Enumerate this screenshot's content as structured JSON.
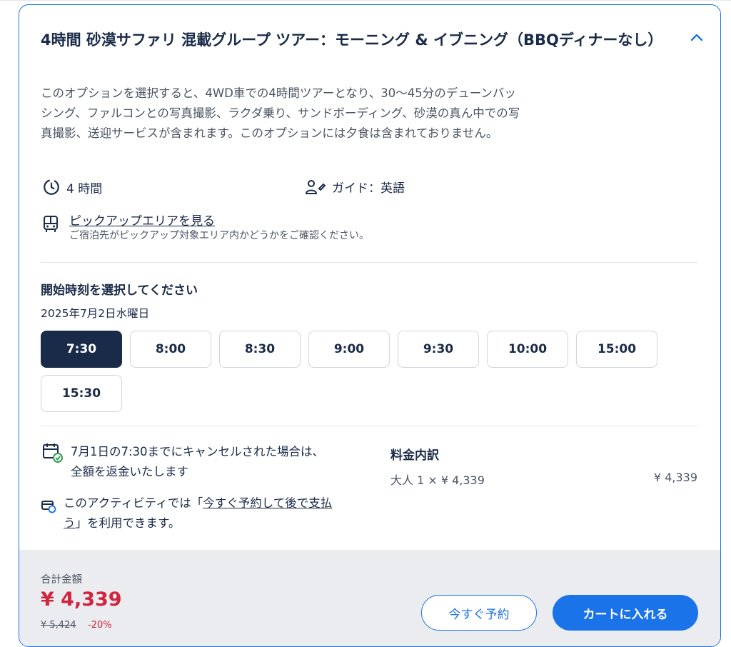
{
  "option": {
    "title": "4時間 砂漠サファリ 混載グループ ツアー：モーニング & イブニング（BBQディナーなし）",
    "description": "このオプションを選択すると、4WD車での4時間ツアーとなり、30〜45分のデューンバッシング、ファルコンとの写真撮影、ラクダ乗り、サンドボーディング、砂漠の真ん中での写真撮影、送迎サービスが含まれます。このオプションには夕食は含まれておりません。",
    "duration": "4 時間",
    "guide": "ガイド：英語",
    "pickup_link": "ピックアップエリアを見る",
    "pickup_sub": "ご宿泊先がピックアップ対象エリア内かどうかをご確認ください。"
  },
  "schedule": {
    "title": "開始時刻を選択してください",
    "date": "2025年7月2日水曜日",
    "times": [
      "7:30",
      "8:00",
      "8:30",
      "9:00",
      "9:30",
      "10:00",
      "15:00",
      "15:30"
    ],
    "selected": "7:30"
  },
  "cancellation": {
    "text": "7月1日の7:30までにキャンセルされた場合は、全額を返金いたします"
  },
  "paylater": {
    "prefix": "このアクティビティでは「",
    "link": "今すぐ予約して後で支払う",
    "suffix": "」を利用できます。"
  },
  "price_breakdown": {
    "title": "料金内訳",
    "line_label": "大人 1 × ¥ 4,339",
    "line_amount": "¥ 4,339"
  },
  "footer": {
    "total_label": "合計金額",
    "total_price": "¥ 4,339",
    "original_price": "¥ 5,424",
    "discount": "-20%",
    "reserve_label": "今すぐ予約",
    "cart_label": "カートに入れる"
  },
  "colors": {
    "primary": "#1a73e8",
    "navy": "#1a2b49",
    "price_red": "#d0243f"
  }
}
